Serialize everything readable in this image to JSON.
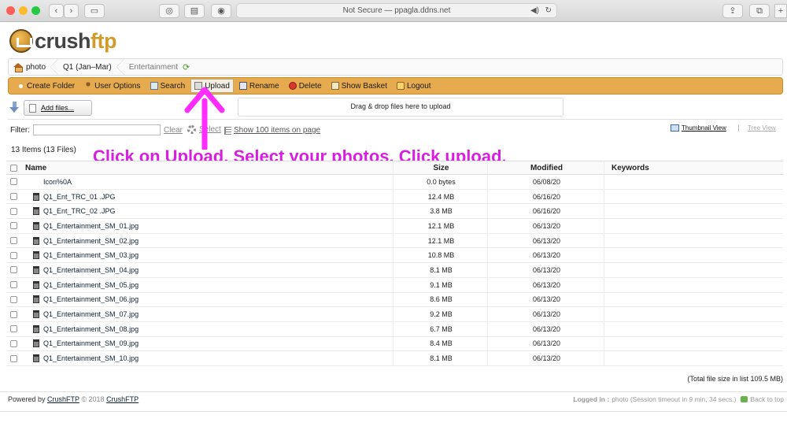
{
  "browser": {
    "url_text": "Not Secure — ppagla.ddns.net",
    "sound_icon": "speaker-icon",
    "reload_icon": "reload-icon"
  },
  "logo": {
    "part1": "crush",
    "part2": "ftp"
  },
  "breadcrumb": [
    {
      "label": "photo"
    },
    {
      "label": "Q1 (Jan–Mar)"
    },
    {
      "label": "Entertainment"
    }
  ],
  "toolbar": {
    "create_folder": "Create Folder",
    "user_options": "User Options",
    "search": "Search",
    "upload": "Upload",
    "rename": "Rename",
    "delete": "Delete",
    "show_basket": "Show Basket",
    "logout": "Logout",
    "accent": "#e6ab4e"
  },
  "upload": {
    "add_files": "Add files...",
    "dropzone": "Drag & drop files here to upload"
  },
  "filter": {
    "label": "Filter:",
    "value": "",
    "clear": "Clear",
    "select": "Select",
    "show_items": "Show 100 items on page",
    "thumbnail_view": "Thumbnail View",
    "tree_view": "Tree View"
  },
  "item_count": "13 Items (13 Files)",
  "annotation": {
    "text": "Click on Upload. Select your photos. Click upload.",
    "color": "#d81fe0"
  },
  "table": {
    "headers": {
      "name": "Name",
      "size": "Size",
      "modified": "Modified",
      "keywords": "Keywords"
    },
    "rows": [
      {
        "name": "Icon%0A",
        "size": "0.0 bytes",
        "modified": "06/08/20",
        "keywords": ""
      },
      {
        "name": "Q1_Ent_TRC_01 .JPG",
        "size": "12.4 MB",
        "modified": "06/16/20",
        "keywords": ""
      },
      {
        "name": "Q1_Ent_TRC_02 .JPG",
        "size": "3.8 MB",
        "modified": "06/16/20",
        "keywords": ""
      },
      {
        "name": "Q1_Entertainment_SM_01.jpg",
        "size": "12.1 MB",
        "modified": "06/13/20",
        "keywords": ""
      },
      {
        "name": "Q1_Entertainment_SM_02.jpg",
        "size": "12.1 MB",
        "modified": "06/13/20",
        "keywords": ""
      },
      {
        "name": "Q1_Entertainment_SM_03.jpg",
        "size": "10.8 MB",
        "modified": "06/13/20",
        "keywords": ""
      },
      {
        "name": "Q1_Entertainment_SM_04.jpg",
        "size": "8.1 MB",
        "modified": "06/13/20",
        "keywords": ""
      },
      {
        "name": "Q1_Entertainment_SM_05.jpg",
        "size": "9.1 MB",
        "modified": "06/13/20",
        "keywords": ""
      },
      {
        "name": "Q1_Entertainment_SM_06.jpg",
        "size": "8.6 MB",
        "modified": "06/13/20",
        "keywords": ""
      },
      {
        "name": "Q1_Entertainment_SM_07.jpg",
        "size": "9.2 MB",
        "modified": "06/13/20",
        "keywords": ""
      },
      {
        "name": "Q1_Entertainment_SM_08.jpg",
        "size": "6.7 MB",
        "modified": "06/13/20",
        "keywords": ""
      },
      {
        "name": "Q1_Entertainment_SM_09.jpg",
        "size": "8.4 MB",
        "modified": "06/13/20",
        "keywords": ""
      },
      {
        "name": "Q1_Entertainment_SM_10.jpg",
        "size": "8.1 MB",
        "modified": "06/13/20",
        "keywords": ""
      }
    ]
  },
  "total": "(Total file size in list 109.5 MB)",
  "footer": {
    "powered_prefix": "Powered by",
    "powered_link": "CrushFTP",
    "copyright": "© 2018",
    "copyright_link": "CrushFTP",
    "logged_in_label": "Logged in :",
    "logged_in_text": "photo (Session timeout in 9 min, 34 secs.)",
    "back_to_top": "Back to top"
  }
}
